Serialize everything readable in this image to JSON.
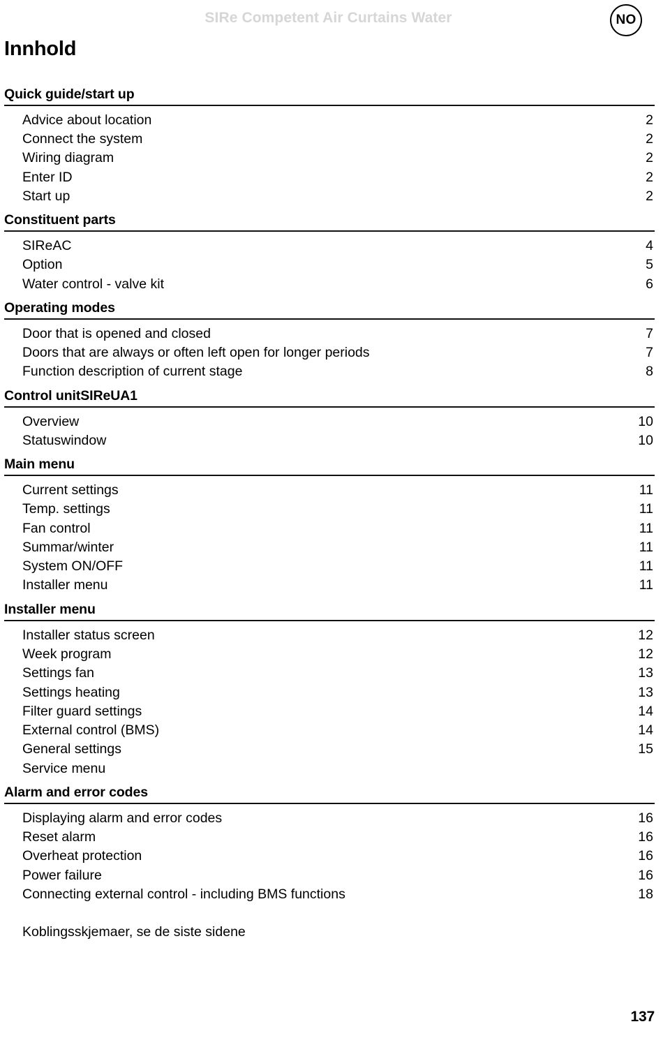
{
  "header": {
    "doc_title": "SIRe Competent Air Curtains Water",
    "language_badge": "NO"
  },
  "page_heading": "Innhold",
  "toc": {
    "sections": [
      {
        "title": "Quick guide/start up",
        "entries": [
          {
            "label": "Advice about location",
            "page": "2"
          },
          {
            "label": "Connect the system",
            "page": "2"
          },
          {
            "label": "Wiring diagram",
            "page": "2"
          },
          {
            "label": "Enter ID",
            "page": "2"
          },
          {
            "label": "Start up",
            "page": "2"
          }
        ]
      },
      {
        "title": "Constituent parts",
        "entries": [
          {
            "label": "SIReAC",
            "page": "4"
          },
          {
            "label": "Option",
            "page": "5"
          },
          {
            "label": "Water control - valve kit",
            "page": "6"
          }
        ]
      },
      {
        "title": "Operating modes",
        "entries": [
          {
            "label": "Door that is opened and closed",
            "page": "7"
          },
          {
            "label": "Doors that are always or often left open for longer periods",
            "page": "7"
          },
          {
            "label": "Function description of current stage",
            "page": "8"
          }
        ]
      },
      {
        "title": "Control unitSIReUA1",
        "entries": [
          {
            "label": "Overview",
            "page": "10"
          },
          {
            "label": "Statuswindow",
            "page": "10"
          }
        ]
      },
      {
        "title": "Main menu",
        "entries": [
          {
            "label": "Current settings",
            "page": "11"
          },
          {
            "label": "Temp. settings",
            "page": "11"
          },
          {
            "label": "Fan control",
            "page": "11"
          },
          {
            "label": "Summar/winter",
            "page": "11"
          },
          {
            "label": "System ON/OFF",
            "page": "11"
          },
          {
            "label": "Installer menu",
            "page": "11"
          }
        ]
      },
      {
        "title": "Installer menu",
        "entries": [
          {
            "label": "Installer status screen",
            "page": "12"
          },
          {
            "label": "Week program",
            "page": "12"
          },
          {
            "label": "Settings fan",
            "page": "13"
          },
          {
            "label": "Settings heating",
            "page": "13"
          },
          {
            "label": "Filter guard settings",
            "page": "14"
          },
          {
            "label": "External control (BMS)",
            "page": "14"
          },
          {
            "label": "General settings",
            "page": "15"
          },
          {
            "label": "Service menu",
            "page": ""
          }
        ]
      },
      {
        "title": "Alarm and error codes",
        "entries": [
          {
            "label": "Displaying alarm and error codes",
            "page": "16"
          },
          {
            "label": "Reset alarm",
            "page": "16"
          },
          {
            "label": "Overheat protection",
            "page": "16"
          },
          {
            "label": "Power failure",
            "page": "16"
          },
          {
            "label": "Connecting external control - including BMS functions",
            "page": "18"
          }
        ]
      }
    ],
    "closing_note": "Koblingsskjemaer, se de siste sidene"
  },
  "footer": {
    "page_number": "137"
  }
}
